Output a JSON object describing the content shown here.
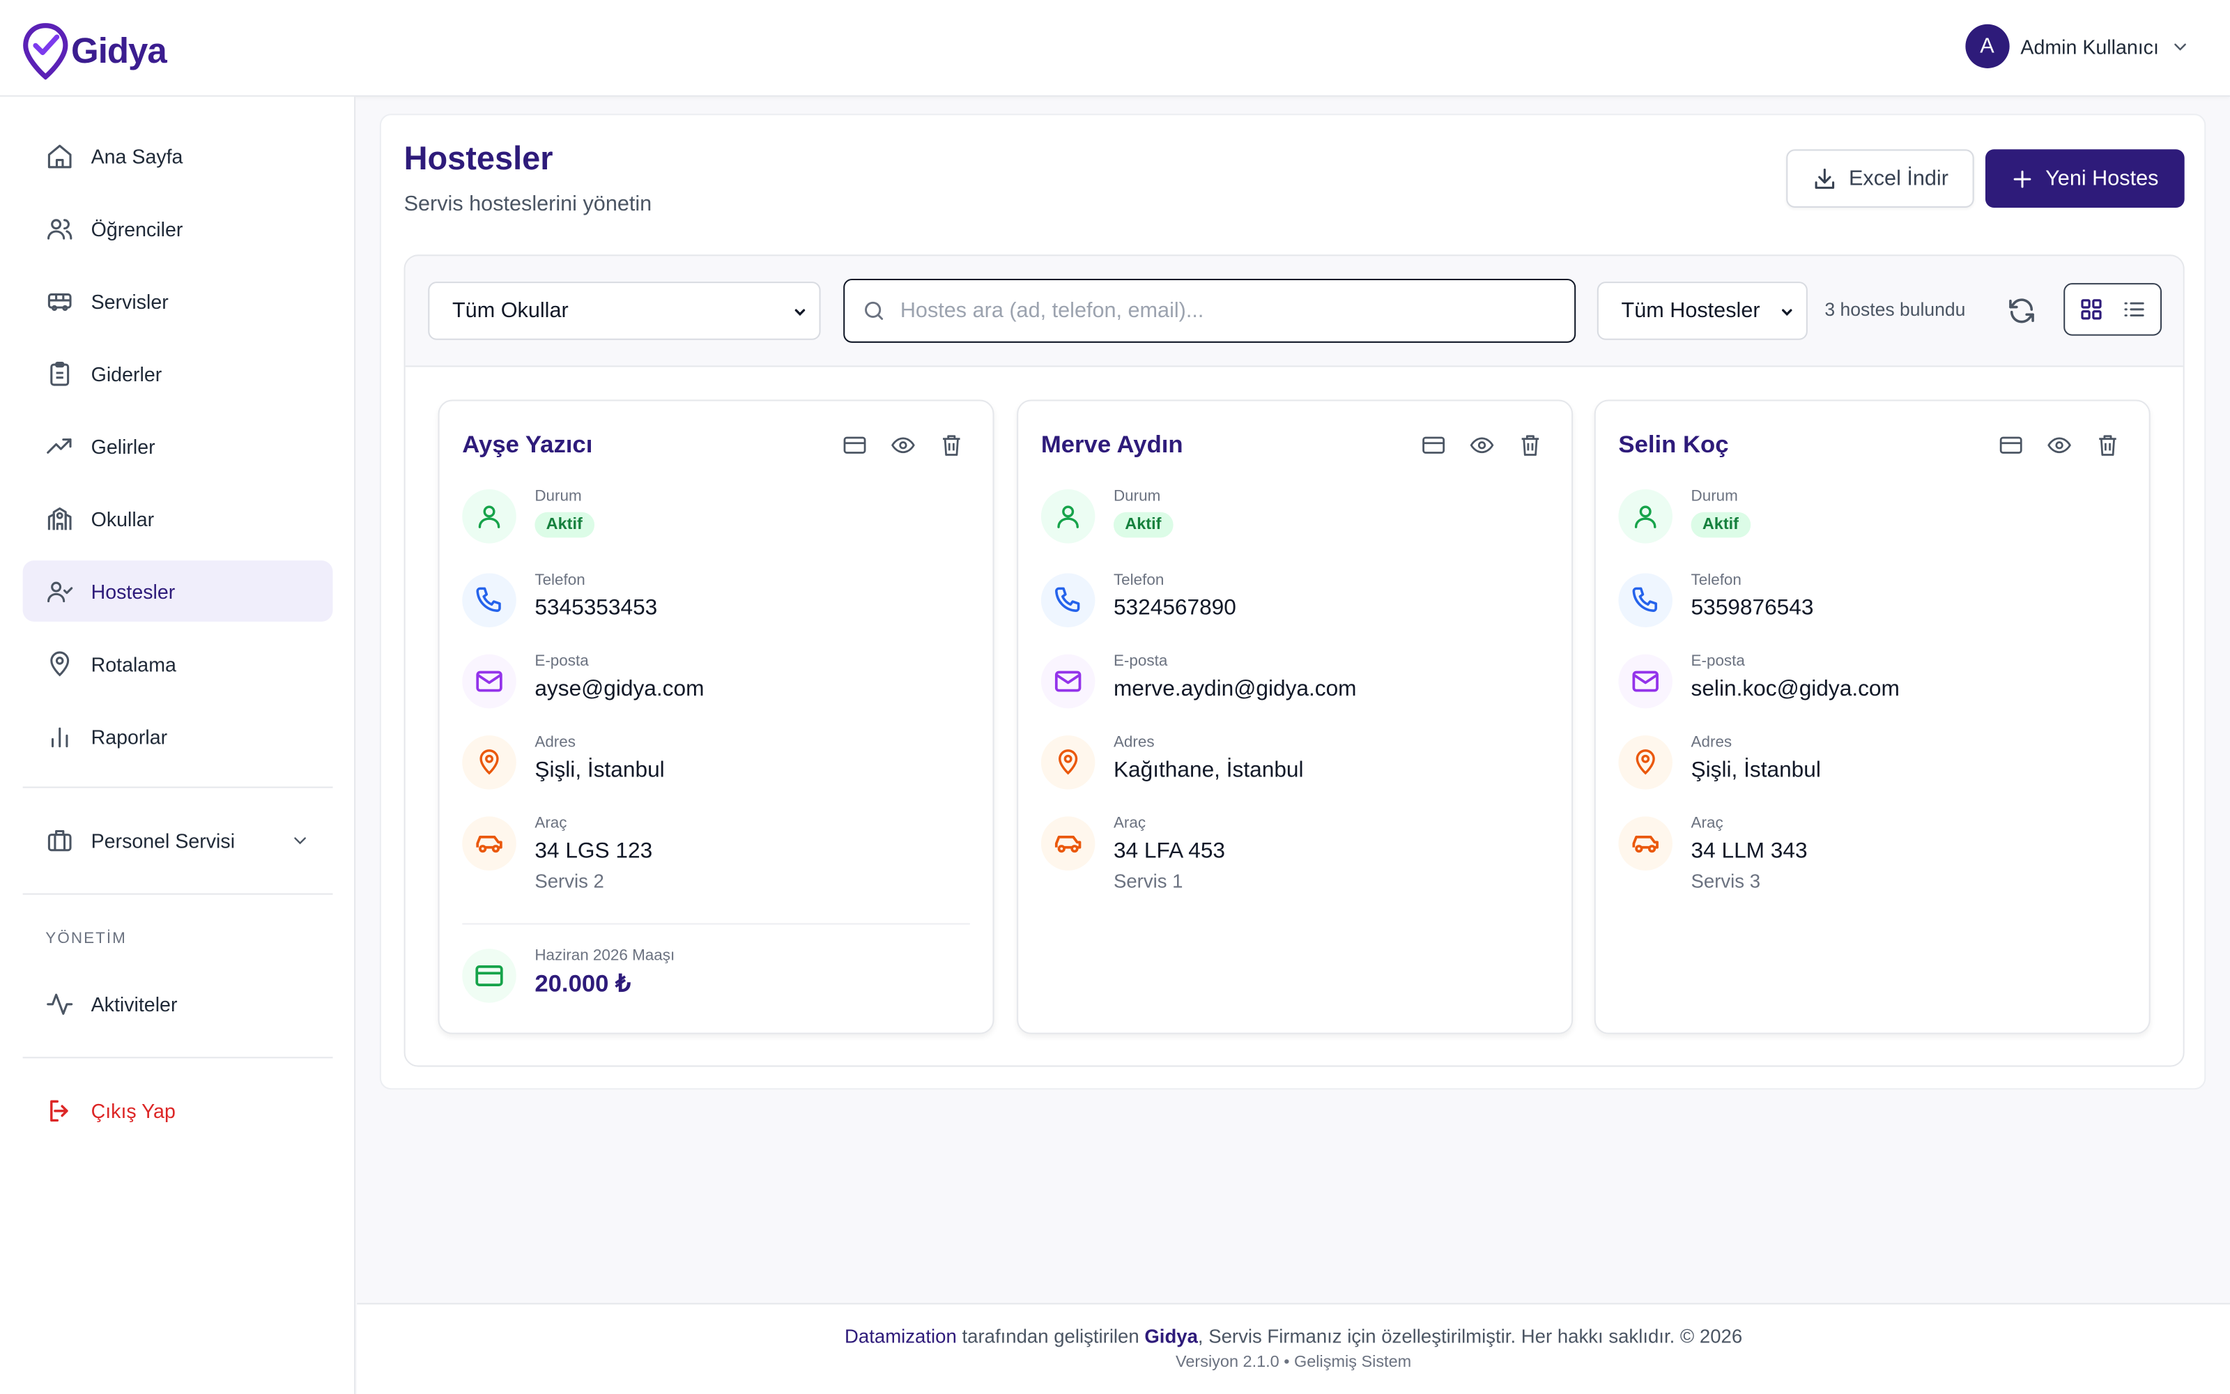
{
  "app": {
    "name": "Gidya"
  },
  "colors": {
    "brand": "#2e1b7a",
    "active_green": "#15803d",
    "logout_red": "#dc2626"
  },
  "user": {
    "initial": "A",
    "name": "Admin Kullanıcı"
  },
  "sidebar": {
    "items": [
      {
        "label": "Ana Sayfa",
        "icon": "home-icon"
      },
      {
        "label": "Öğrenciler",
        "icon": "users-icon"
      },
      {
        "label": "Servisler",
        "icon": "bus-icon"
      },
      {
        "label": "Giderler",
        "icon": "clipboard-icon"
      },
      {
        "label": "Gelirler",
        "icon": "trending-up-icon"
      },
      {
        "label": "Okullar",
        "icon": "school-icon"
      },
      {
        "label": "Hostesler",
        "icon": "user-check-icon",
        "active": true
      },
      {
        "label": "Rotalama",
        "icon": "map-pin-icon"
      },
      {
        "label": "Raporlar",
        "icon": "bar-chart-icon"
      }
    ],
    "personnel": {
      "label": "Personel Servisi",
      "icon": "briefcase-icon"
    },
    "section_label": "YÖNETİM",
    "activities": {
      "label": "Aktiviteler",
      "icon": "activity-icon"
    },
    "logout": {
      "label": "Çıkış Yap",
      "icon": "logout-icon"
    }
  },
  "page": {
    "title": "Hostesler",
    "subtitle": "Servis hostеslerini yönetin",
    "excel_button": "Excel İndir",
    "new_button": "Yeni Hostes"
  },
  "filters": {
    "school_select": "Tüm Okullar",
    "search_placeholder": "Hostes ara (ad, telefon, email)...",
    "status_select": "Tüm Hostesler",
    "result_count": "3 hostes bulundu"
  },
  "field_labels": {
    "status": "Durum",
    "phone": "Telefon",
    "email": "E-posta",
    "address": "Adres",
    "vehicle": "Araç"
  },
  "hostesses": [
    {
      "name": "Ayşe Yazıcı",
      "status": "Aktif",
      "phone": "5345353453",
      "email": "ayse@gidya.com",
      "address": "Şişli, İstanbul",
      "plate": "34 LGS 123",
      "service": "Servis 2",
      "salary_label": "Haziran 2026 Maaşı",
      "salary": "20.000 ₺"
    },
    {
      "name": "Merve Aydın",
      "status": "Aktif",
      "phone": "5324567890",
      "email": "merve.aydin@gidya.com",
      "address": "Kağıthane, İstanbul",
      "plate": "34 LFA 453",
      "service": "Servis 1"
    },
    {
      "name": "Selin Koç",
      "status": "Aktif",
      "phone": "5359876543",
      "email": "selin.koc@gidya.com",
      "address": "Şişli, İstanbul",
      "plate": "34 LLM 343",
      "service": "Servis 3"
    }
  ],
  "footer": {
    "company": "Datamization",
    "text_mid": " tarafından geliştirilen ",
    "product": "Gidya",
    "text_end": ", Servis Firmanız için özelleştirilmiştir. Her hakkı saklıdır. © 2026",
    "version": "Versiyon 2.1.0 • Gelişmiş Sistem"
  }
}
